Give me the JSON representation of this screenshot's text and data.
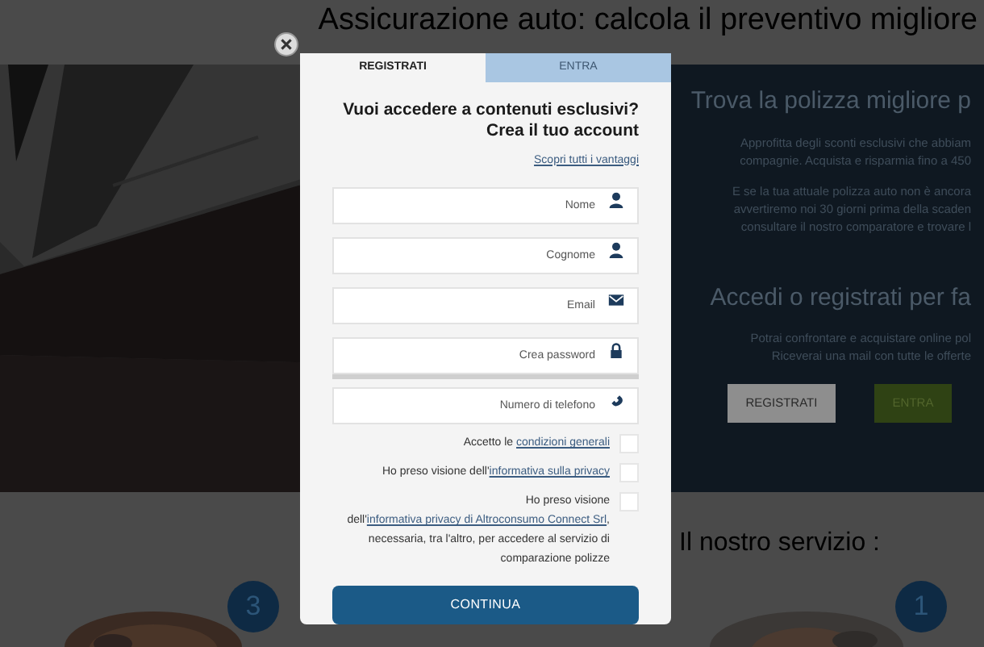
{
  "page": {
    "title": "Assicurazione auto: calcola il preventivo migliore",
    "panel": {
      "heading": "Trova la polizza migliore p",
      "paragraphs": [
        [
          "Approfitta degli sconti esclusivi che abbiam",
          "compagnie. Acquista e risparmia fino a 450"
        ],
        [
          "E se la tua attuale polizza auto non è ancora",
          "avvertiremo noi 30 giorni prima della scaden",
          "consultare il nostro comparatore e trovare l"
        ]
      ],
      "heading2": "Accedi o registrati per fa",
      "paragraphs2": [
        [
          "Potrai confrontare e acquistare online pol",
          "Riceverai una mail con tutte le offerte"
        ]
      ],
      "buttons": [
        {
          "label": "REGISTRATI",
          "kind": "outline"
        },
        {
          "label": "ENTRA",
          "kind": "primary"
        }
      ]
    },
    "service_heading": "Il nostro servizio :",
    "steps": [
      "3",
      "1"
    ]
  },
  "modal": {
    "tabs": [
      {
        "label": "REGISTRATI",
        "selected": true
      },
      {
        "label": "ENTRA",
        "selected": false
      }
    ],
    "heading": "Vuoi accedere a contenuti esclusivi? Crea il tuo account",
    "link": "Scopri tutti i vantaggi",
    "fields": [
      {
        "placeholder": "Nome",
        "kind": "user"
      },
      {
        "placeholder": "Cognome",
        "kind": "user"
      },
      {
        "placeholder": "Email",
        "kind": "email"
      },
      {
        "placeholder": "Crea password",
        "kind": "password"
      },
      {
        "placeholder": "Numero di telefono",
        "kind": "phone"
      }
    ],
    "checkboxes": [
      {
        "before": "Accetto le ",
        "link": "condizioni generali",
        "checked": false
      },
      {
        "before": "Ho preso visione dell'",
        "link": "informativa sulla privacy",
        "checked": false
      },
      {
        "before": "Ho preso visione dell'",
        "link": "informativa privacy di Altroconsumo Connect Srl",
        "after": ", necessaria, tra l'altro, per accedere al servizio di comparazione polizze",
        "checked": false
      }
    ],
    "submit": "CONTINUA"
  }
}
